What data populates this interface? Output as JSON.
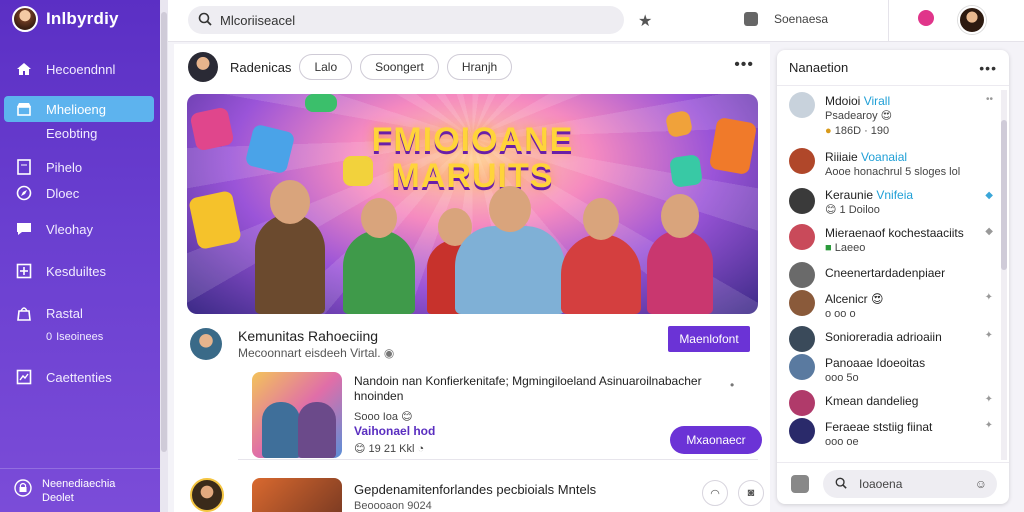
{
  "app": {
    "brand": "Inlbyrdiy"
  },
  "sidebar": {
    "items": [
      {
        "label": "Hecoendnnl",
        "icon": "home-icon"
      },
      {
        "label": "Mhelioeng",
        "icon": "store-icon",
        "active": true
      },
      {
        "label": "Eeobting",
        "sub": true
      },
      {
        "label": "Pihelo",
        "icon": "file-icon"
      },
      {
        "label": "Dloec",
        "icon": "compass-icon"
      },
      {
        "label": "Vleohay",
        "icon": "chat-icon"
      },
      {
        "label": "Kesduiltes",
        "icon": "plus-square-icon"
      },
      {
        "label": "Rastal",
        "icon": "bag-icon"
      },
      {
        "label": "Iseoinees",
        "sub": true,
        "prefix": "0"
      },
      {
        "label": "Caettenties",
        "icon": "grid-icon"
      }
    ],
    "footer": {
      "line1": "Neenediaechia",
      "line2": "Deolet"
    }
  },
  "topbar": {
    "search_value": "Mlcoriiseacel",
    "label": "Soenaesa"
  },
  "filters": {
    "first": "Radenicas",
    "chips": [
      "Lalo",
      "Soongert",
      "Hranjh"
    ]
  },
  "banner": {
    "title_l1": "FMIOIOANE",
    "title_l2": "MARUITS"
  },
  "post": {
    "title": "Kemunitas Rahoeciing",
    "subtitle": "Mecoonnart eisdeeh Virtal.",
    "action": "Maenlofont",
    "card": {
      "text": "Nandoin nan Konfierkenitafe; Mgmingiloeland Asinuaroilnabacher hnoinden",
      "meta1": "Sooo Ioa",
      "meta2": "Vaihonael hod",
      "meta3": "19 21 Kkl",
      "button": "Mxaonaecr"
    }
  },
  "post2": {
    "title": "Gepdenamitenforlandes pecbioials Mntels",
    "subtitle": "Beoooaon 9024"
  },
  "panel": {
    "title": "Nanaetion",
    "items": [
      {
        "l1a": "Mdoioi ",
        "l1b": "Virall",
        "l2": "Psadearoy",
        "l3": "186D · 190"
      },
      {
        "l1a": "Riiiaie ",
        "l1b": "Voanaial",
        "l2": "Aooe honachrul 5 sloges lol"
      },
      {
        "l1a": "Keraunie ",
        "l1b": "Vnifeia",
        "l2": "1 Doiloo"
      },
      {
        "l1a": "Mieraenaof kochestaaciits",
        "l1b": "",
        "l2": "Laeeo"
      },
      {
        "l1a": "Cneenertardadenpiaer",
        "l1b": "",
        "l2": ""
      },
      {
        "l1a": "Alcenicr",
        "l1b": "",
        "l2": "o oo o"
      },
      {
        "l1a": "Sonioreradia adrioaiin",
        "l1b": "",
        "l2": ""
      },
      {
        "l1a": "Panoaae Idoeoitas",
        "l1b": "",
        "l2": "ooo 5o"
      },
      {
        "l1a": "Kmean dandelieg",
        "l1b": "",
        "l2": ""
      },
      {
        "l1a": "Feraeae ststiig fiinat",
        "l1b": "",
        "l2": "ooo oe"
      }
    ],
    "footer_input": "Ioaoena"
  },
  "colors": {
    "accent": "#6b33d6",
    "sidebar": "#5b2fc4",
    "active": "#5db3ee",
    "link": "#1f9fd6"
  }
}
